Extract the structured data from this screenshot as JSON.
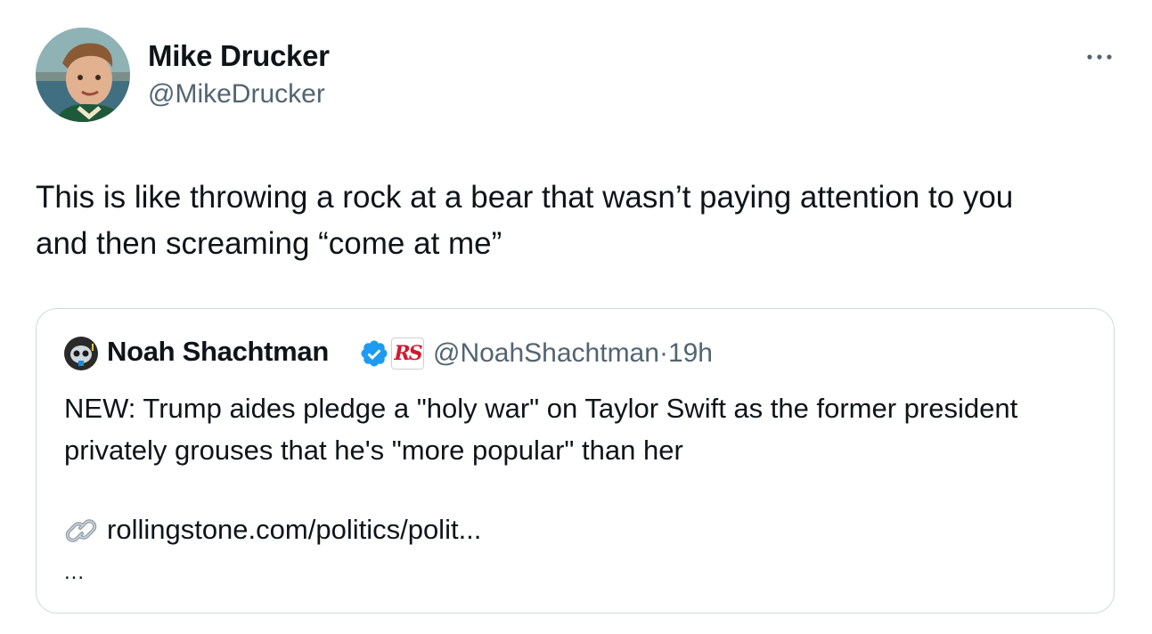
{
  "tweet": {
    "author_name": "Mike Drucker",
    "author_handle": "@MikeDrucker",
    "avatar_icon": "profile-photo",
    "more_icon": "more-horizontal-icon",
    "text": "This is like throwing a rock at a bear that wasn’t paying attention to you\nand then screaming “come at me”"
  },
  "quote": {
    "author_name": "Noah Shachtman",
    "verified_icon": "verified-badge-icon",
    "verified_color": "#1d9bf0",
    "affiliate_badge_text": "RS",
    "affiliate_badge_color": "#d3182d",
    "author_handle": "@NoahShachtman",
    "separator": "·",
    "time": "19h",
    "text": "NEW: Trump aides pledge a \"holy war\" on Taylor Swift as the former president privately grouses that he's \"more popular\" than her",
    "link_icon": "link-icon",
    "link_text": "rollingstone.com/politics/polit...",
    "truncation": "..."
  }
}
